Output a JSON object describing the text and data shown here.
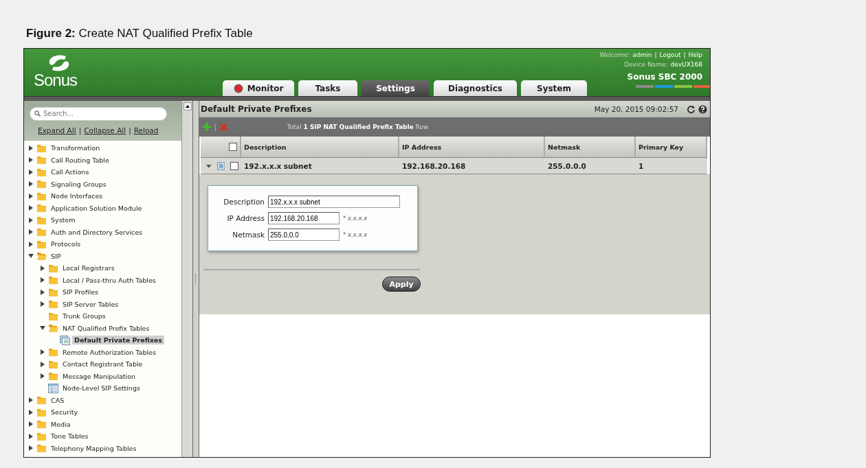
{
  "caption": "**Figure 2:** Create NAT Qualified Prefix Table",
  "header": {
    "logo_text": "Sonus",
    "welcome_label": "Welcome:",
    "user": "admin",
    "separator": "|",
    "logout": "Logout",
    "help": "Help",
    "device_label": "Device Name:",
    "device_name": "devUX168",
    "product": "Sonus SBC 2000"
  },
  "tabs": [
    {
      "label": "Monitor",
      "kind": "status",
      "selected": false
    },
    {
      "label": "Tasks",
      "kind": "plain",
      "selected": false
    },
    {
      "label": "Settings",
      "kind": "plain",
      "selected": true
    },
    {
      "label": "Diagnostics",
      "kind": "plain",
      "selected": false
    },
    {
      "label": "System",
      "kind": "plain",
      "selected": false
    }
  ],
  "sidebar": {
    "search": {
      "placeholder": "Search..."
    },
    "links": [
      "Expand All",
      "Collapse All",
      "Reload"
    ],
    "link_separator": "|",
    "tree": [
      {
        "label": "Transformation",
        "kind": "folder",
        "expanded": false,
        "selected": false
      },
      {
        "label": "Call Routing Table",
        "kind": "folder",
        "expanded": false,
        "selected": false
      },
      {
        "label": "Call Actions",
        "kind": "folder",
        "expanded": false,
        "selected": false
      },
      {
        "label": "Signaling Groups",
        "kind": "folder",
        "expanded": false,
        "selected": false
      },
      {
        "label": "Node Interfaces",
        "kind": "folder",
        "expanded": false,
        "selected": false
      },
      {
        "label": "Application Solution Module",
        "kind": "folder",
        "expanded": false,
        "selected": false
      },
      {
        "label": "System",
        "kind": "folder",
        "expanded": false,
        "selected": false
      },
      {
        "label": "Auth and Directory Services",
        "kind": "folder",
        "expanded": false,
        "selected": false
      },
      {
        "label": "Protocols",
        "kind": "folder",
        "expanded": false,
        "selected": false
      },
      {
        "label": "SIP",
        "kind": "folder",
        "expanded": true,
        "selected": false,
        "children": [
          {
            "label": "Local Registrars",
            "kind": "folder",
            "expanded": false,
            "selected": false
          },
          {
            "label": "Local / Pass-thru Auth Tables",
            "kind": "folder",
            "expanded": false,
            "selected": false
          },
          {
            "label": "SIP Profiles",
            "kind": "folder",
            "expanded": false,
            "selected": false
          },
          {
            "label": "SIP Server Tables",
            "kind": "folder",
            "expanded": false,
            "selected": false
          },
          {
            "label": "Trunk Groups",
            "kind": "leaf-folder",
            "selected": false
          },
          {
            "label": "NAT Qualified Prefix Tables",
            "kind": "folder",
            "expanded": true,
            "selected": false,
            "children": [
              {
                "label": "Default Private Prefixes",
                "kind": "table-list",
                "selected": true
              }
            ]
          },
          {
            "label": "Remote Authorization Tables",
            "kind": "folder",
            "expanded": false,
            "selected": false
          },
          {
            "label": "Contact Registrant Table",
            "kind": "folder",
            "expanded": false,
            "selected": false
          },
          {
            "label": "Message Manipulation",
            "kind": "folder",
            "expanded": false,
            "selected": false
          },
          {
            "label": "Node-Level SIP Settings",
            "kind": "settings",
            "selected": false
          }
        ]
      },
      {
        "label": "CAS",
        "kind": "folder",
        "expanded": false,
        "selected": false
      },
      {
        "label": "Security",
        "kind": "folder",
        "expanded": false,
        "selected": false
      },
      {
        "label": "Media",
        "kind": "folder",
        "expanded": false,
        "selected": false
      },
      {
        "label": "Tone Tables",
        "kind": "folder",
        "expanded": false,
        "selected": false
      },
      {
        "label": "Telephony Mapping Tables",
        "kind": "folder",
        "expanded": false,
        "selected": false
      }
    ]
  },
  "panel": {
    "title": "Default Private Prefixes",
    "timestamp": "May 20, 2015 09:02:57",
    "toolbar_separator": "|",
    "summary": "Total **1 SIP NAT Qualified Prefix Table** Row",
    "table": {
      "select_all_checked": false,
      "columns": [
        "Description",
        "IP Address",
        "Netmask",
        "Primary Key"
      ],
      "rows": [
        {
          "expanded": true,
          "checked": false,
          "cells": [
            "192.x.x.x subnet",
            "192.168.20.168",
            "255.0.0.0",
            "1"
          ]
        }
      ]
    },
    "form": {
      "fields": [
        {
          "label": "Description",
          "value": "192.x.x.x subnet"
        },
        {
          "label": "IP Address",
          "value": "192.168.20.168",
          "hint": "* x.x.x.x"
        },
        {
          "label": "Netmask",
          "value": "255.0.0.0",
          "hint": "* x.x.x.x"
        }
      ],
      "apply": "Apply"
    }
  }
}
